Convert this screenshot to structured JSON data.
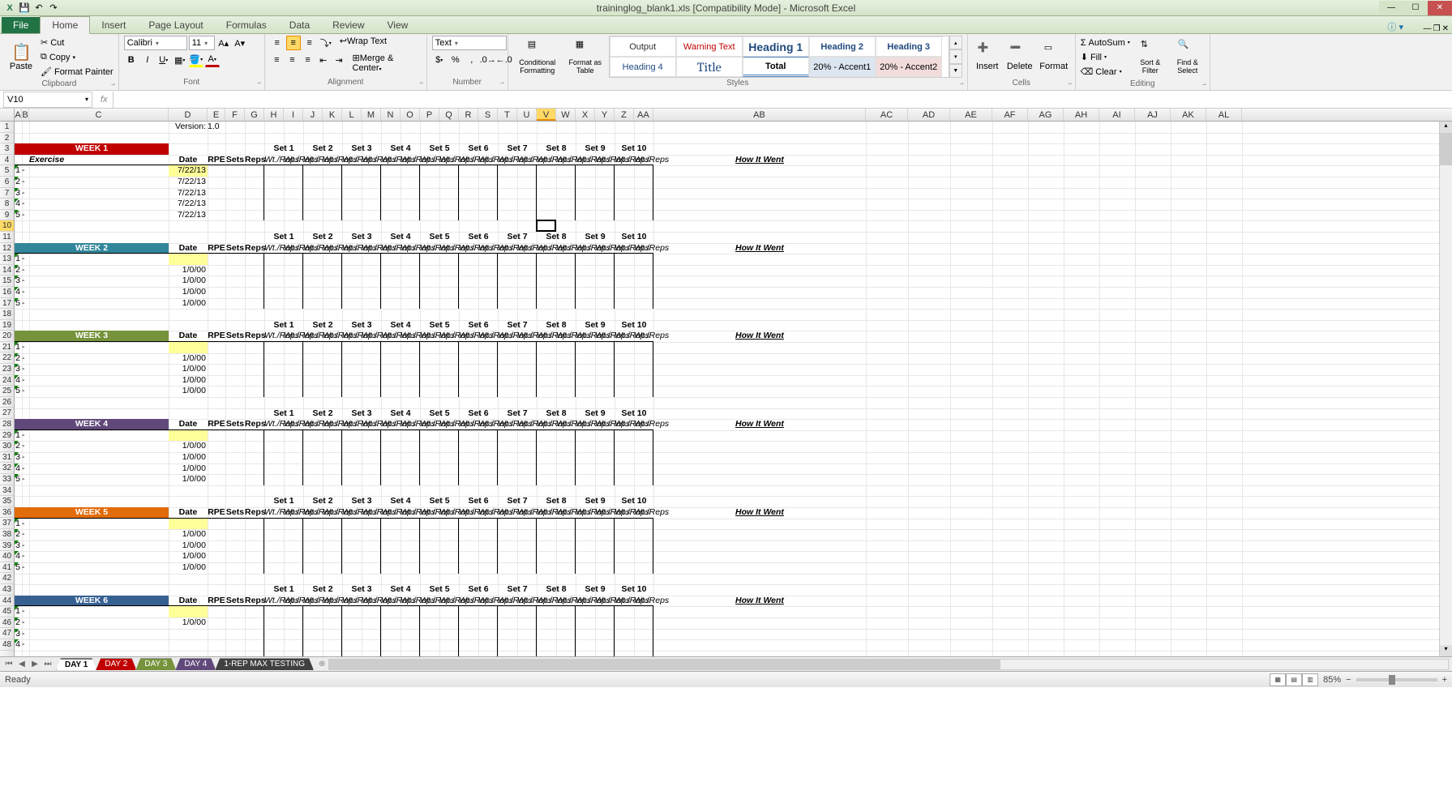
{
  "app": {
    "title": "traininglog_blank1.xls  [Compatibility Mode] - Microsoft Excel"
  },
  "ribbon": {
    "file": "File",
    "tabs": [
      "Home",
      "Insert",
      "Page Layout",
      "Formulas",
      "Data",
      "Review",
      "View"
    ],
    "active_tab": "Home",
    "clipboard": {
      "paste": "Paste",
      "cut": "Cut",
      "copy": "Copy",
      "format_painter": "Format Painter",
      "label": "Clipboard"
    },
    "font": {
      "name": "Calibri",
      "size": "11",
      "label": "Font"
    },
    "alignment": {
      "wrap": "Wrap Text",
      "merge": "Merge & Center",
      "label": "Alignment"
    },
    "number": {
      "format": "Text",
      "label": "Number"
    },
    "styles": {
      "conditional": "Conditional Formatting",
      "as_table": "Format as Table",
      "cells": [
        "Output",
        "Warning Text",
        "Heading 1",
        "Heading 2",
        "Heading 3",
        "Heading 4",
        "Title",
        "Total",
        "20% - Accent1",
        "20% - Accent2"
      ],
      "label": "Styles"
    },
    "cells_grp": {
      "insert": "Insert",
      "delete": "Delete",
      "format": "Format",
      "label": "Cells"
    },
    "editing": {
      "autosum": "AutoSum",
      "fill": "Fill",
      "clear": "Clear",
      "sort": "Sort & Filter",
      "find": "Find & Select",
      "label": "Editing"
    }
  },
  "formula_bar": {
    "name_box": "V10",
    "fx": "fx",
    "formula": ""
  },
  "columns": {
    "letters": [
      "A",
      "B",
      "C",
      "D",
      "E",
      "F",
      "G",
      "H",
      "I",
      "J",
      "K",
      "L",
      "M",
      "N",
      "O",
      "P",
      "Q",
      "R",
      "S",
      "T",
      "U",
      "V",
      "W",
      "X",
      "Y",
      "Z",
      "AA",
      "AB",
      "AC",
      "AD",
      "AE",
      "AF",
      "AG",
      "AH",
      "AI",
      "AJ",
      "AK",
      "AL"
    ],
    "widths": [
      9,
      9,
      172,
      48,
      22,
      24,
      24,
      24,
      24,
      24,
      24,
      24,
      24,
      24,
      24,
      24,
      24,
      24,
      24,
      24,
      24,
      24,
      24,
      24,
      24,
      24,
      24,
      262,
      52,
      52,
      52,
      44,
      44,
      44,
      44,
      44,
      44,
      44
    ],
    "selected": "V"
  },
  "rows": {
    "count": 48,
    "selected": 10,
    "height": 13.6
  },
  "sheet": {
    "version_label": "Version:",
    "version_value": "1.0",
    "set_headers": [
      "Set 1",
      "Set 2",
      "Set 3",
      "Set 4",
      "Set 5",
      "Set 6",
      "Set 7",
      "Set 8",
      "Set 9",
      "Set 10"
    ],
    "col_headers": {
      "date": "Date",
      "rpe": "RPE",
      "sets": "Sets",
      "reps": "Reps",
      "wtrep": "Wt./Reps",
      "howit": "How It Went",
      "exercise": "Exercise"
    },
    "weeks": [
      {
        "n": 1,
        "title": "WEEK 1",
        "color": "wk1",
        "row": 3,
        "dates": [
          "7/22/13",
          "7/22/13",
          "7/22/13",
          "7/22/13",
          "7/22/13"
        ],
        "yellow_first": true
      },
      {
        "n": 2,
        "title": "WEEK 2",
        "color": "wk2",
        "row": 12,
        "dates": [
          "",
          "1/0/00",
          "1/0/00",
          "1/0/00",
          "1/0/00"
        ],
        "yellow_first": true,
        "sets_row_offset": -1
      },
      {
        "n": 3,
        "title": "WEEK 3",
        "color": "wk3",
        "row": 20,
        "dates": [
          "",
          "1/0/00",
          "1/0/00",
          "1/0/00",
          "1/0/00"
        ],
        "yellow_first": true,
        "sets_row_offset": -1
      },
      {
        "n": 4,
        "title": "WEEK 4",
        "color": "wk4",
        "row": 28,
        "dates": [
          "",
          "1/0/00",
          "1/0/00",
          "1/0/00",
          "1/0/00"
        ],
        "yellow_first": true,
        "sets_row_offset": -1
      },
      {
        "n": 5,
        "title": "WEEK 5",
        "color": "wk5",
        "row": 36,
        "dates": [
          "",
          "1/0/00",
          "1/0/00",
          "1/0/00",
          "1/0/00"
        ],
        "yellow_first": true,
        "sets_row_offset": -1
      },
      {
        "n": 6,
        "title": "WEEK 6",
        "color": "wk6",
        "row": 44,
        "dates": [
          "",
          "1/0/00",
          "",
          ""
        ],
        "yellow_first": true,
        "sets_row_offset": -1
      }
    ],
    "row_nums": [
      "1",
      "2",
      "3",
      "4",
      "5"
    ],
    "dash": "-"
  },
  "sheet_tabs": {
    "tabs": [
      {
        "name": "DAY 1",
        "cls": "active"
      },
      {
        "name": "DAY 2",
        "cls": "day2"
      },
      {
        "name": "DAY 3",
        "cls": "day3"
      },
      {
        "name": "DAY 4",
        "cls": "day4"
      },
      {
        "name": "1-REP MAX TESTING",
        "cls": "maxtest"
      }
    ]
  },
  "statusbar": {
    "ready": "Ready",
    "zoom": "85%"
  }
}
